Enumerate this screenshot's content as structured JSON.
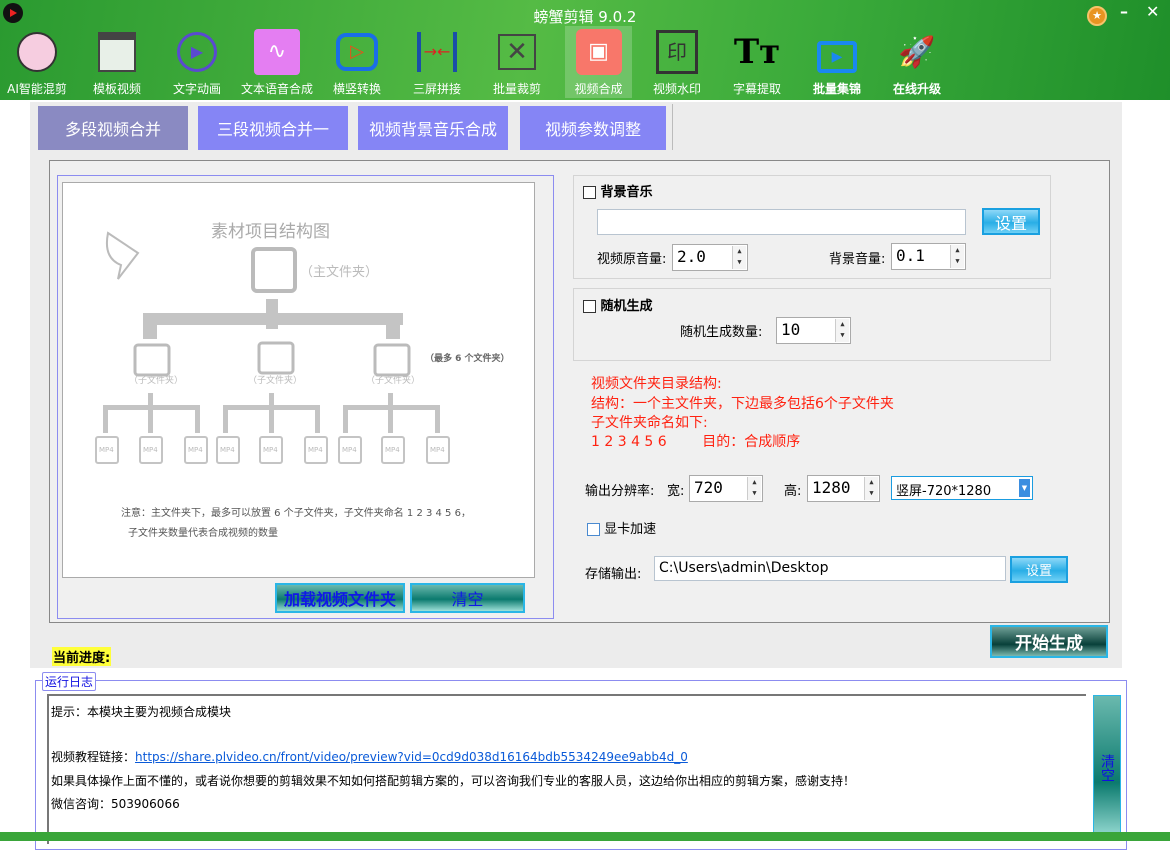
{
  "app": {
    "title": "螃蟹剪辑 9.0.2"
  },
  "toolbar": [
    {
      "label": "AI智能混剪",
      "icon": "ai-scissors-icon"
    },
    {
      "label": "模板视频",
      "icon": "template-icon"
    },
    {
      "label": "文字动画",
      "icon": "film-globe-icon"
    },
    {
      "label": "文本语音合成",
      "icon": "waveform-icon"
    },
    {
      "label": "横竖转换",
      "icon": "rotate-play-icon"
    },
    {
      "label": "三屏拼接",
      "icon": "split-arrows-icon"
    },
    {
      "label": "批量裁剪",
      "icon": "crop-icon"
    },
    {
      "label": "视频合成",
      "icon": "grid-shapes-icon"
    },
    {
      "label": "视频水印",
      "icon": "watermark-icon"
    },
    {
      "label": "字幕提取",
      "icon": "text-tt-icon"
    },
    {
      "label": "批量集锦",
      "icon": "camera-scissors-icon"
    },
    {
      "label": "在线升级",
      "icon": "rocket-icon"
    }
  ],
  "tabs": [
    "多段视频合并",
    "三段视频合并一",
    "视频背景音乐合成",
    "视频参数调整"
  ],
  "diagram": {
    "title": "素材项目结构图",
    "main_folder": "（主文件夹）",
    "sub_folder": "（子文件夹）",
    "max_note": "（最多 6 个文件夹）",
    "file": "MP4",
    "note1": "注意：主文件夹下，最多可以放置 6 个子文件夹，子文件夹命名 1 2 3 4 5 6，",
    "note2": "子文件夹数量代表合成视频的数量"
  },
  "left_buttons": {
    "load": "加载视频文件夹",
    "clear": "清空"
  },
  "bgm": {
    "label": "背景音乐",
    "path": "",
    "set": "设置",
    "orig_vol_label": "视频原音量:",
    "orig_vol": "2.0",
    "bg_vol_label": "背景音量:",
    "bg_vol": "0.1"
  },
  "random": {
    "label": "随机生成",
    "count_label": "随机生成数量:",
    "count": "10"
  },
  "info": [
    "视频文件夹目录结构:",
    "结构：一个主文件夹，下边最多包括6个子文件夹",
    "子文件夹命名如下:",
    "1 2 3 4 5 6        目的：合成顺序"
  ],
  "output": {
    "res_label": "输出分辨率:",
    "width_label": "宽:",
    "width": "720",
    "height_label": "高:",
    "height": "1280",
    "preset": "竖屏-720*1280",
    "gpu_label": "显卡加速",
    "store_label": "存储输出:",
    "path": "C:\\Users\\admin\\Desktop",
    "set": "设置"
  },
  "start": "开始生成",
  "progress_label": "当前进度:",
  "log": {
    "legend": "运行日志",
    "lines": [
      "提示：本模块主要为视频合成模块",
      "视频教程链接："
    ],
    "link": "https://share.plvideo.cn/front/video/preview?vid=0cd9d038d16164bdb5534249ee9abb4d_0",
    "line3": "如果具体操作上面不懂的，或者说你想要的剪辑效果不知如何搭配剪辑方案的，可以咨询我们专业的客服人员，这边给你出相应的剪辑方案，感谢支持！",
    "line4": "微信咨询：503906066",
    "clear": "清空"
  }
}
